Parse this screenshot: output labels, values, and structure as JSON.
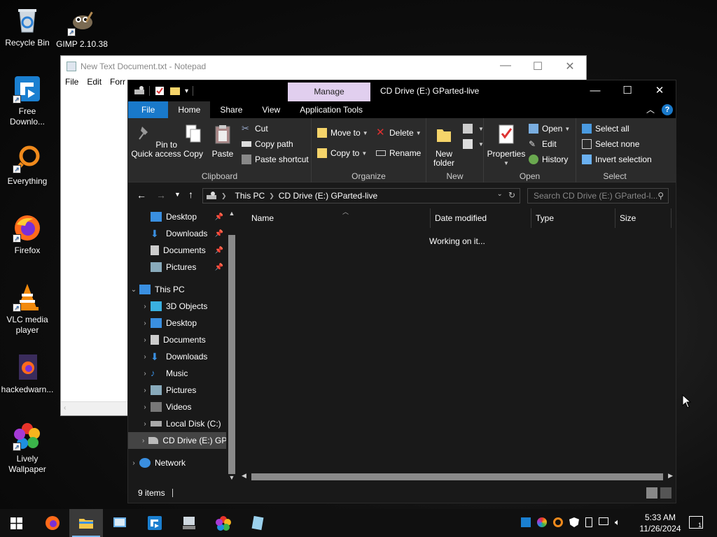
{
  "desktop": {
    "icons": [
      {
        "label": "Recycle Bin"
      },
      {
        "label": "GIMP 2.10.38"
      },
      {
        "label": "Free Downlo..."
      },
      {
        "label": "Everything"
      },
      {
        "label": "Firefox"
      },
      {
        "label": "VLC media player"
      },
      {
        "label": "hackedwarn..."
      },
      {
        "label": "Lively Wallpaper"
      }
    ]
  },
  "notepad": {
    "title": "New Text Document.txt - Notepad",
    "menu": [
      "File",
      "Edit",
      "Forr"
    ],
    "controls": [
      "—",
      "☐",
      "✕"
    ]
  },
  "explorer": {
    "title": "CD Drive (E:) GParted-live",
    "manage_tab": "Manage",
    "controls": [
      "—",
      "☐",
      "✕"
    ],
    "tabs": [
      "File",
      "Home",
      "Share",
      "View",
      "Application Tools"
    ],
    "ribbon": {
      "clipboard": {
        "title": "Clipboard",
        "pin": "Pin to Quick access",
        "copy": "Copy",
        "paste": "Paste",
        "cut": "Cut",
        "copy_path": "Copy path",
        "paste_shortcut": "Paste shortcut"
      },
      "organize": {
        "title": "Organize",
        "move_to": "Move to",
        "copy_to": "Copy to",
        "delete": "Delete",
        "rename": "Rename"
      },
      "new": {
        "title": "New",
        "new_folder": "New folder"
      },
      "open": {
        "title": "Open",
        "properties": "Properties",
        "open": "Open",
        "edit": "Edit",
        "history": "History"
      },
      "select": {
        "title": "Select",
        "select_all": "Select all",
        "select_none": "Select none",
        "invert": "Invert selection"
      }
    },
    "address": {
      "crumbs": [
        "This PC",
        "CD Drive (E:) GParted-live"
      ],
      "search_placeholder": "Search CD Drive (E:) GParted-l..."
    },
    "nav": {
      "quick": [
        "Desktop",
        "Downloads",
        "Documents",
        "Pictures"
      ],
      "this_pc": "This PC",
      "pc_items": [
        "3D Objects",
        "Desktop",
        "Documents",
        "Downloads",
        "Music",
        "Pictures",
        "Videos",
        "Local Disk (C:)",
        "CD Drive (E:) GP..."
      ],
      "network": "Network"
    },
    "columns": [
      "Name",
      "Date modified",
      "Type",
      "Size"
    ],
    "working": "Working on it...",
    "status": "9 items"
  },
  "taskbar": {
    "time": "5:33 AM",
    "date": "11/26/2024",
    "notif_count": "1"
  }
}
